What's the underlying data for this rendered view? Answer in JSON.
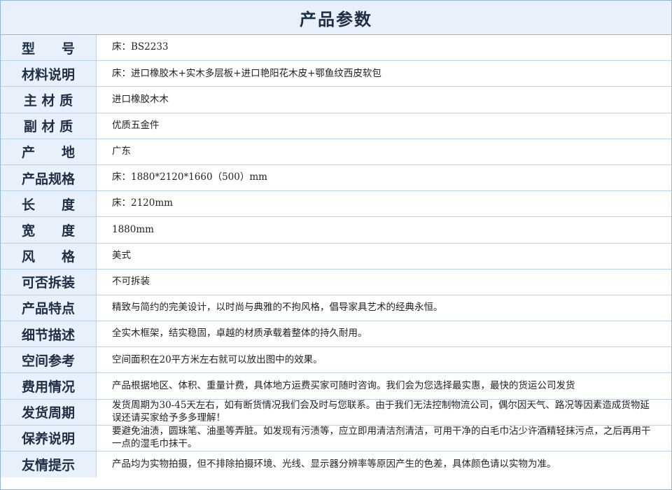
{
  "title": "产品参数",
  "rows": [
    {
      "label": "型　　号",
      "value": "床：BS2233"
    },
    {
      "label": "材料说明",
      "value": "床：进口橡胶木+实木多层板+进口艳阳花木皮+鄂鱼纹西皮软包"
    },
    {
      "label": "主 材 质",
      "value": "进口橡胶木木"
    },
    {
      "label": "副 材 质",
      "value": "优质五金件"
    },
    {
      "label": "产　　地",
      "value": "广东"
    },
    {
      "label": "产品规格",
      "value": "床：1880*2120*1660（500）mm"
    },
    {
      "label": "长　　度",
      "value": "床：2120mm"
    },
    {
      "label": "宽　　度",
      "value": "1880mm"
    },
    {
      "label": "风　　格",
      "value": "美式"
    },
    {
      "label": "可否拆装",
      "value": "不可拆装"
    },
    {
      "label": "产品特点",
      "value": "精致与简约的完美设计，以时尚与典雅的不拘风格，倡导家具艺术的经典永恒。"
    },
    {
      "label": "细节描述",
      "value": "全实木框架，结实稳固，卓越的材质承载着整体的持久耐用。"
    },
    {
      "label": "空间参考",
      "value": "空间面积在20平方米左右就可以放出图中的效果。"
    },
    {
      "label": "费用情况",
      "value": "产品根据地区、体积、重量计费，具体地方运费买家可随时咨询。我们会为您选择最实惠，最快的货运公司发货"
    },
    {
      "label": "发货周期",
      "value": "发货周期为30-45天左右，如有断货情况我们会及时与您联系。由于我们无法控制物流公司，偶尔因天气、路况等因素造成货物延误还请买家给予多多理解！"
    },
    {
      "label": "保养说明",
      "value": "要避免油渍，圆珠笔、油墨等弄脏。如发现有污渍等，应立即用清洁剂清洁，可用干净的白毛巾沾少许酒精轻抹污点，之后再用干一点的湿毛巾抹干。"
    },
    {
      "label": "友情提示",
      "value": "产品均为实物拍摄，但不排除拍摄环境、光线、显示器分辨率等原因产生的色差，具体颜色请以实物为准。"
    }
  ]
}
